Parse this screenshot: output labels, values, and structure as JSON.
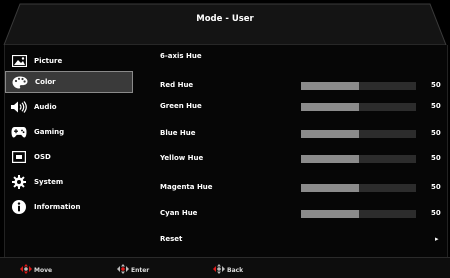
{
  "window": {
    "title": "Mode - User"
  },
  "sidebar": {
    "items": [
      {
        "label": "Picture",
        "icon": "picture-icon",
        "active": false
      },
      {
        "label": "Color",
        "icon": "palette-icon",
        "active": true
      },
      {
        "label": "Audio",
        "icon": "speaker-icon",
        "active": false
      },
      {
        "label": "Gaming",
        "icon": "gamepad-icon",
        "active": false
      },
      {
        "label": "OSD",
        "icon": "osd-icon",
        "active": false
      },
      {
        "label": "System",
        "icon": "gear-icon",
        "active": false
      },
      {
        "label": "Information",
        "icon": "info-icon",
        "active": false
      }
    ]
  },
  "main": {
    "heading": "6-axis Hue",
    "rows": [
      {
        "label": "Red Hue",
        "value": "50",
        "level": 50
      },
      {
        "label": "Green Hue",
        "value": "50",
        "level": 50
      },
      {
        "label": "Blue Hue",
        "value": "50",
        "level": 50
      },
      {
        "label": "Yellow Hue",
        "value": "50",
        "level": 50
      },
      {
        "label": "Magenta Hue",
        "value": "50",
        "level": 50
      },
      {
        "label": "Cyan Hue",
        "value": "50",
        "level": 50
      }
    ],
    "reset": {
      "label": "Reset",
      "arrow": "▸"
    }
  },
  "footer": {
    "hints": [
      {
        "label": "Move",
        "icon": "dpad-move-icon"
      },
      {
        "label": "Enter",
        "icon": "dpad-enter-icon"
      },
      {
        "label": "Back",
        "icon": "dpad-back-icon"
      }
    ]
  },
  "colors": {
    "accent": "#e01818",
    "bar_fill": "#8b8b8b",
    "bar_track": "#2c2c2c",
    "active_bg": "#3a3a3a"
  }
}
